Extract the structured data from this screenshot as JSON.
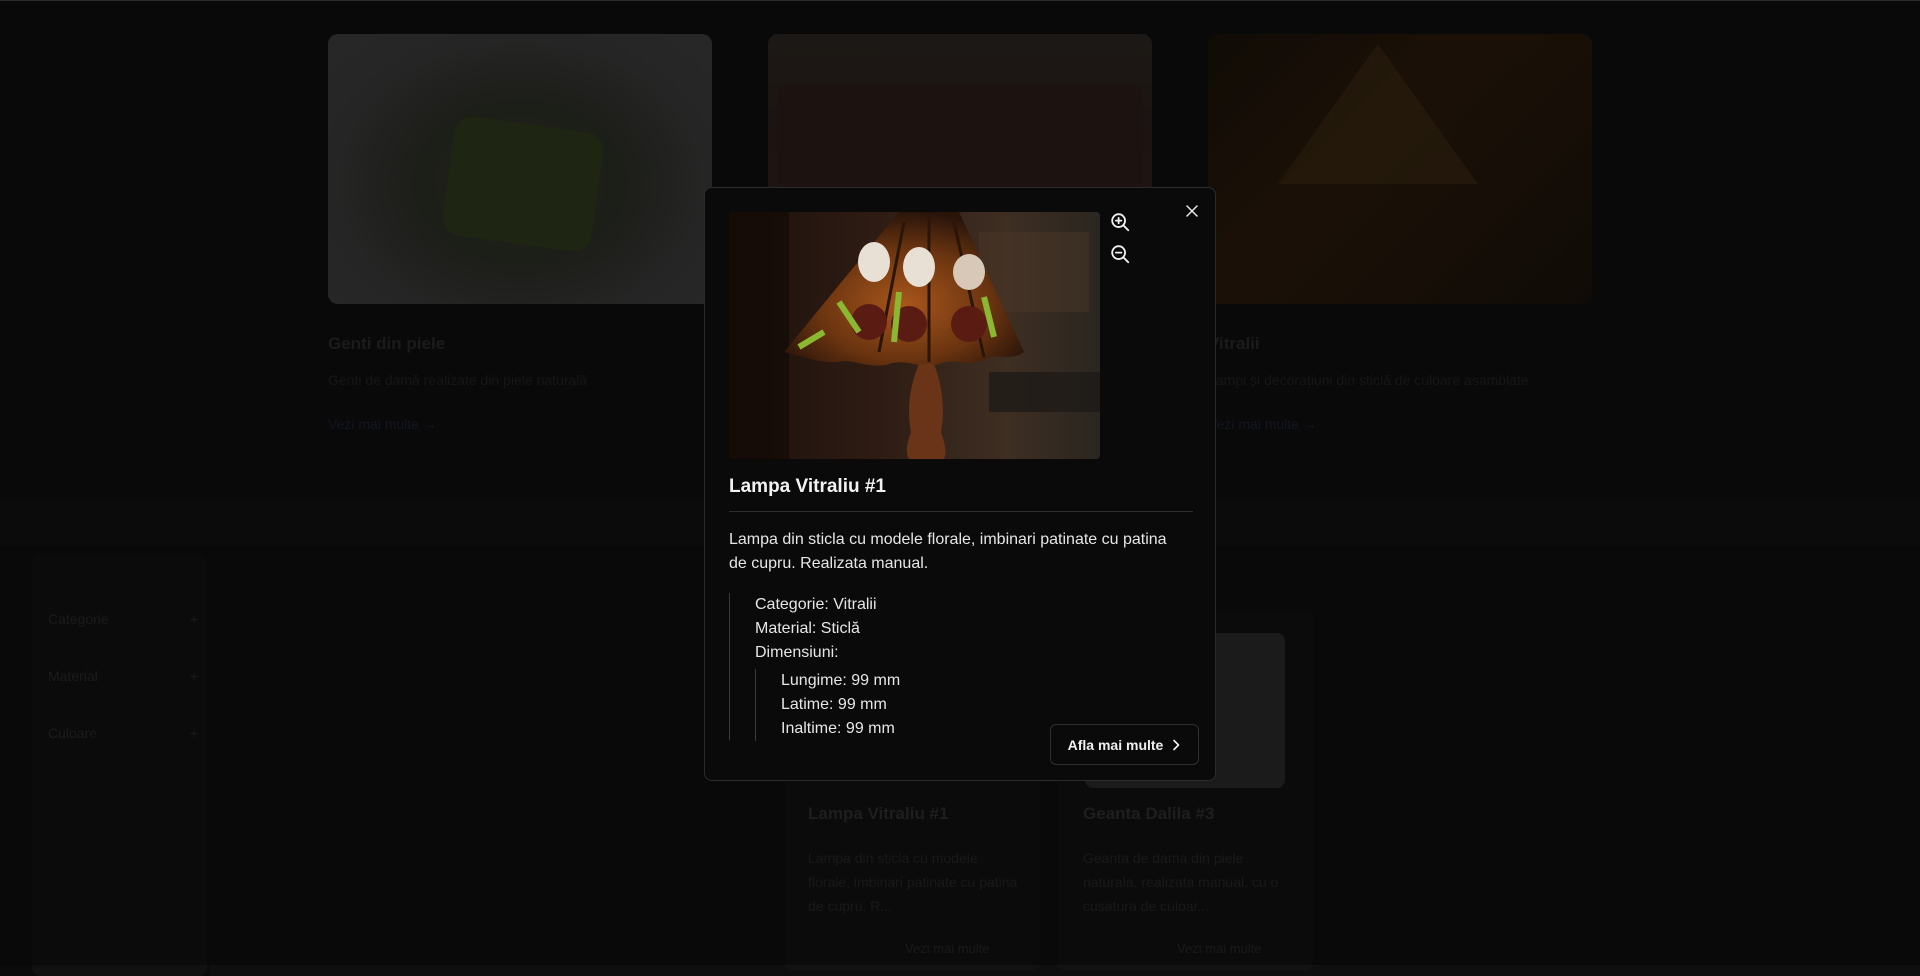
{
  "background": {
    "categories": [
      {
        "title": "Genti din piele",
        "description": "Genti de damă realizate din piele naturală",
        "link": "Vezi mai multe"
      },
      {
        "title": "",
        "description": "",
        "link": ""
      },
      {
        "title": "Vitralii",
        "description": "Lampi și decorațiuni din sticlă de culoare asamblate",
        "link": "Vezi mai multe"
      }
    ],
    "filters": [
      {
        "label": "Categorie",
        "icon": "plus-icon"
      },
      {
        "label": "Material",
        "icon": "plus-icon"
      },
      {
        "label": "Culoare",
        "icon": "plus-icon"
      }
    ],
    "products": [
      {
        "title": "Lampa Vitraliu #1",
        "description": "Lampa din sticla cu modele florale, imbinari patinate cu patina de cupru. R...",
        "link": "Vezi mai multe"
      },
      {
        "title": "Geanta Dalila #3",
        "description": "Geanta de dama din piele naturala, realizata manual, cu o cusatura de culoar...",
        "link": "Vezi mai multe"
      }
    ]
  },
  "modal": {
    "image_alt": "Lampa Vitraliu #1",
    "zoom_in_icon": "zoom-in-icon",
    "zoom_out_icon": "zoom-out-icon",
    "close_icon": "close-icon",
    "title": "Lampa Vitraliu #1",
    "description": "Lampa din sticla cu modele florale, imbinari patinate cu patina de cupru. Realizata manual.",
    "specs": {
      "category": "Categorie: Vitralii",
      "material": "Material: Sticlă",
      "dimensions_label": "Dimensiuni:",
      "length": "Lungime: 99 mm",
      "width": "Latime: 99 mm",
      "height": "Inaltime: 99 mm"
    },
    "cta_label": "Afla mai multe",
    "cta_icon": "chevron-right-icon"
  }
}
